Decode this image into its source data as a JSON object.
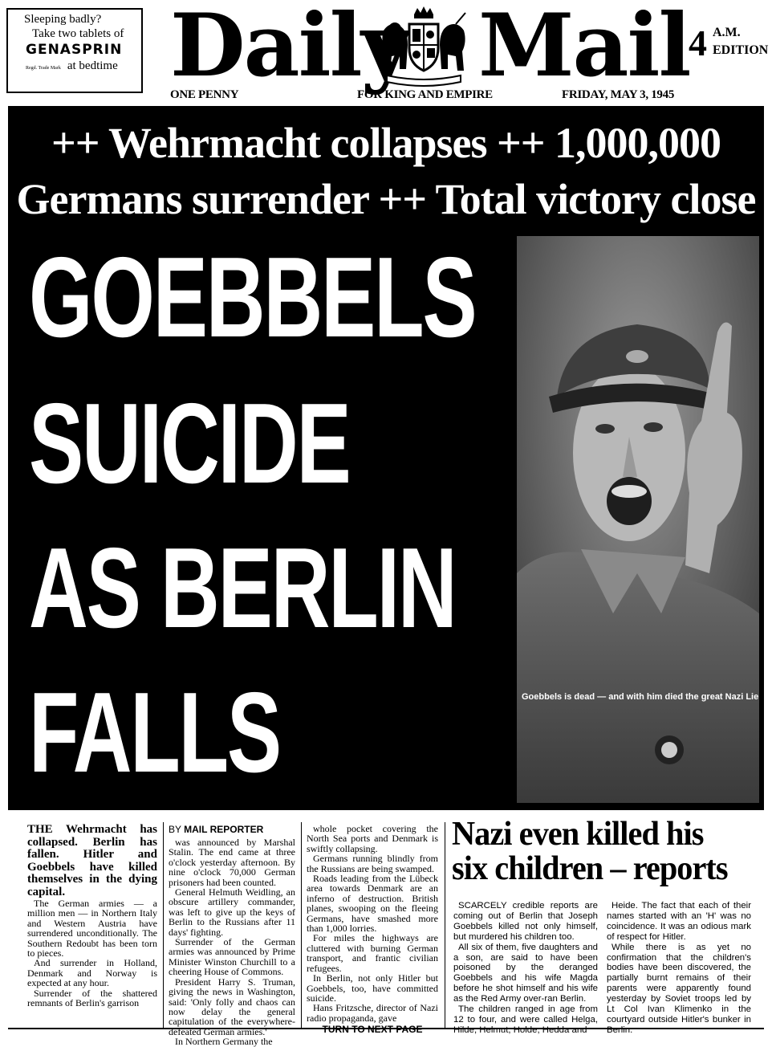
{
  "masthead": {
    "ad": {
      "line1": "Sleeping badly?",
      "line2": "Take two tablets of",
      "brand": "GENASPRIN",
      "trademark": "Regd. Trade Mark",
      "line4": "at bedtime"
    },
    "title_left": "Daily",
    "title_right": "Mail",
    "edition_number": "4",
    "edition_am": "A.M.",
    "edition_label": "EDITION",
    "price": "ONE PENNY",
    "motto": "FOR KING AND EMPIRE",
    "dateline": "FRIDAY, MAY 3, 1945"
  },
  "banner": {
    "strap_line1": "++ Wehrmacht collapses ++ 1,000,000",
    "strap_line2": "Germans surrender ++ Total victory close",
    "headline": [
      "GOEBBELS",
      "SUICIDE",
      "AS BERLIN",
      "FALLS"
    ],
    "photo_caption": "Goebbels is dead — and with him died the great Nazi Lie"
  },
  "main_story": {
    "lead": "THE Wehrmacht has collapsed. Berlin has fallen. Hitler and Goebbels have killed themselves in the dying capital.",
    "col1_paras": [
      "The German armies — a million men — in Northern Italy and Western Austria have surrendered unconditionally. The Southern Redoubt has been torn to pieces.",
      "And surrender in Holland, Denmark and Norway is expected at any hour.",
      "Surrender of the shattered remnants of Berlin's garrison"
    ],
    "byline_prefix": "BY",
    "byline_name": "MAIL REPORTER",
    "col2_paras": [
      "was announced by Marshal Stalin. The end came at three o'clock yesterday afternoon. By nine o'clock 70,000 German prisoners had been counted.",
      "General Helmuth Weidling, an obscure artillery commander, was left to give up the keys of Berlin to the Russians after 11 days' fighting.",
      "Surrender of the German armies was announced by Prime Minister Winston Churchill to a cheering House of Commons.",
      "President Harry S. Truman, giving the news in Washington, said: 'Only folly and chaos can now delay the general capitulation of the everywhere-defeated German armies.'",
      "In Northern Germany the"
    ],
    "col3_paras": [
      "whole pocket covering the North Sea ports and Denmark is swiftly collapsing.",
      "Germans running blindly from the Russians are being swamped.",
      "Roads leading from the Lübeck area towards Denmark are an inferno of destruction. British planes, swooping on the fleeing Germans, have smashed more than 1,000 lorries.",
      "For miles the highways are cluttered with burning German transport, and frantic civilian refugees.",
      "In Berlin, not only Hitler but Goebbels, too, have committed suicide.",
      "Hans Fritzsche, director of Nazi radio propaganda, gave"
    ],
    "turn_label": "TURN TO NEXT PAGE"
  },
  "side_story": {
    "headline_line1": "Nazi even killed his",
    "headline_line2": "six children – reports",
    "col1_paras": [
      "SCARCELY credible reports are coming out of Berlin that Joseph Goebbels killed not only himself, but murdered his children too.",
      "All six of them, five daughters and a son, are said to have been poisoned by the deranged Goebbels and his wife Magda before he shot himself and his wife as the Red Army over-ran Berlin.",
      "The children ranged in age from 12 to four, and were called Helga, Hilde, Helmut, Holde, Hedda and"
    ],
    "col2_paras": [
      "Heide. The fact that each of their names started with an 'H' was no coincidence. It was an odious mark of respect for Hitler.",
      "While there is as yet no confirmation that the children's bodies have been discovered, the partially burnt remains of their parents were apparently found yesterday by Soviet troops led by Lt Col Ivan Klimenko in the courtyard outside Hitler's bunker in Berlin."
    ]
  }
}
